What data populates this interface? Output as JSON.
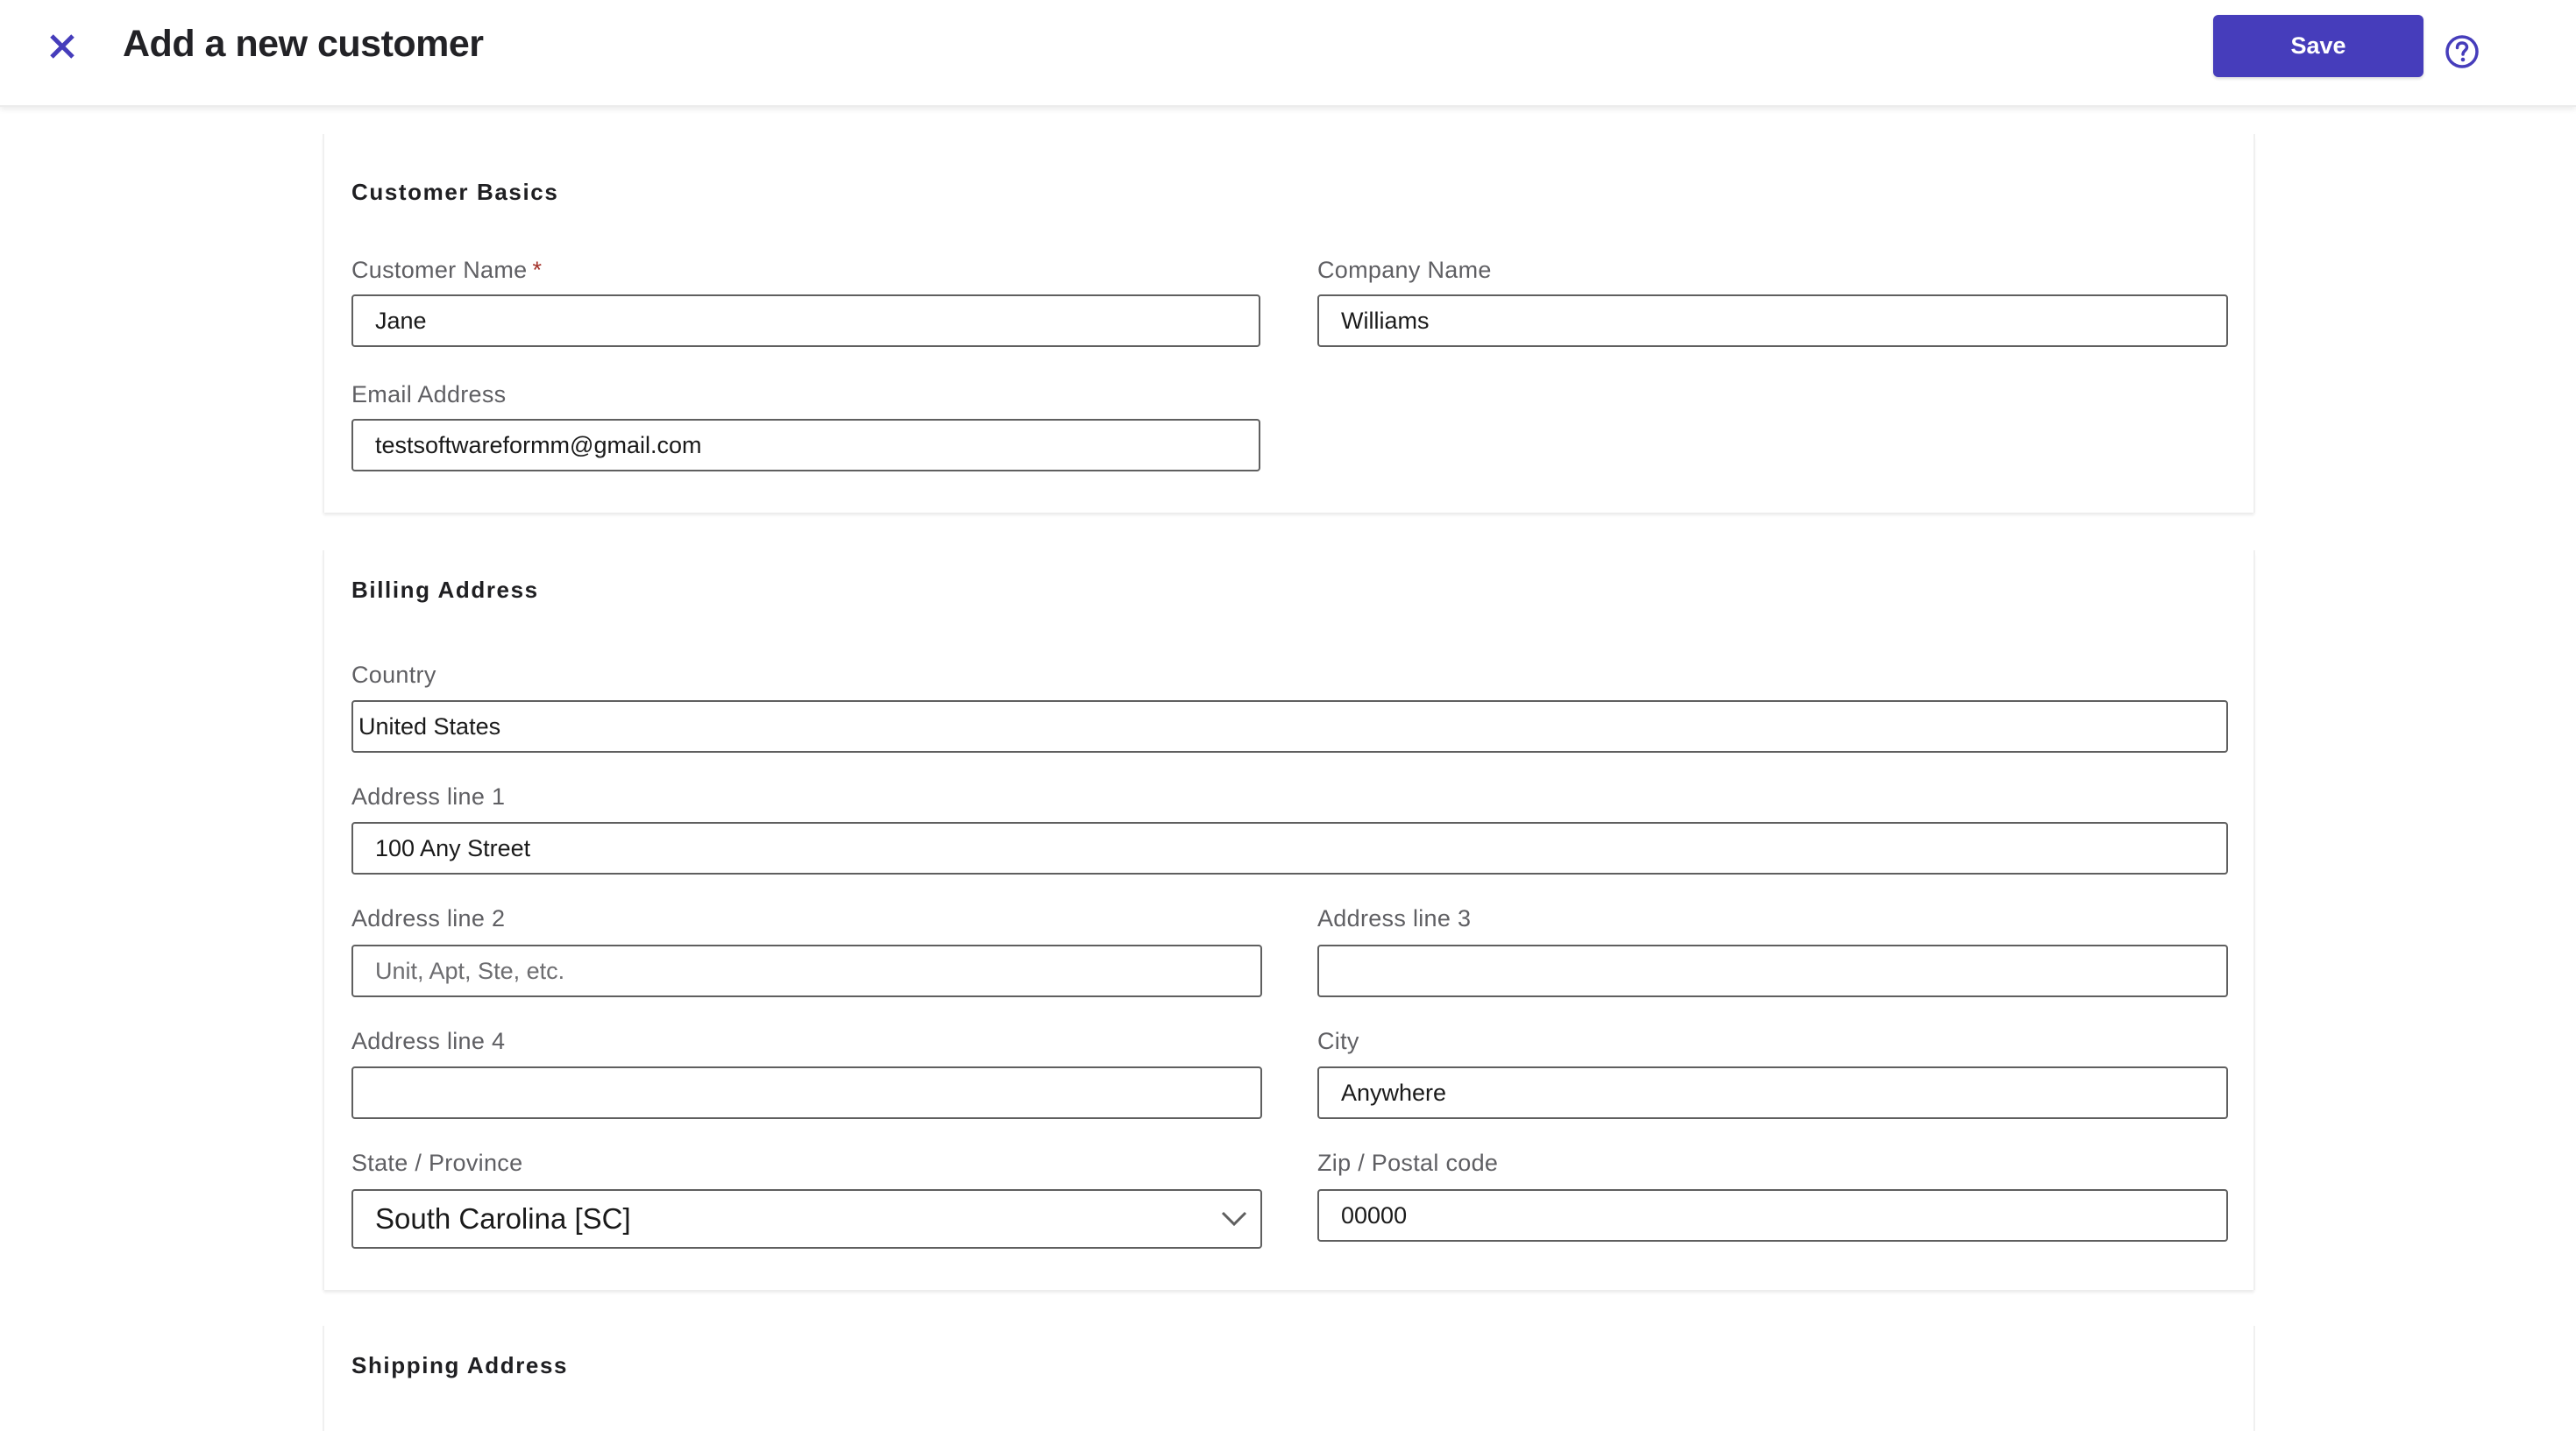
{
  "header": {
    "title": "Add a new customer",
    "save_label": "Save",
    "close_icon": "close-icon",
    "help_icon": "help-circle-icon",
    "accent_color": "#463dbb"
  },
  "sections": {
    "customer_basics": {
      "title": "Customer Basics",
      "fields": {
        "customer_name": {
          "label": "Customer Name",
          "required_marker": "*",
          "value": "Jane"
        },
        "company_name": {
          "label": "Company Name",
          "value": "Williams"
        },
        "email": {
          "label": "Email Address",
          "value": "testsoftwareformm@gmail.com"
        }
      }
    },
    "billing_address": {
      "title": "Billing Address",
      "fields": {
        "country": {
          "label": "Country",
          "value": "United States"
        },
        "address1": {
          "label": "Address line 1",
          "value": "100 Any Street"
        },
        "address2": {
          "label": "Address line 2",
          "value": "",
          "placeholder": "Unit, Apt, Ste, etc."
        },
        "address3": {
          "label": "Address line 3",
          "value": ""
        },
        "address4": {
          "label": "Address line 4",
          "value": ""
        },
        "city": {
          "label": "City",
          "value": "Anywhere"
        },
        "state": {
          "label": "State / Province",
          "value": "South Carolina [SC]",
          "icon": "chevron-down-icon"
        },
        "zip": {
          "label": "Zip / Postal code",
          "value": "00000"
        }
      }
    },
    "shipping_address": {
      "title": "Shipping Address"
    }
  }
}
